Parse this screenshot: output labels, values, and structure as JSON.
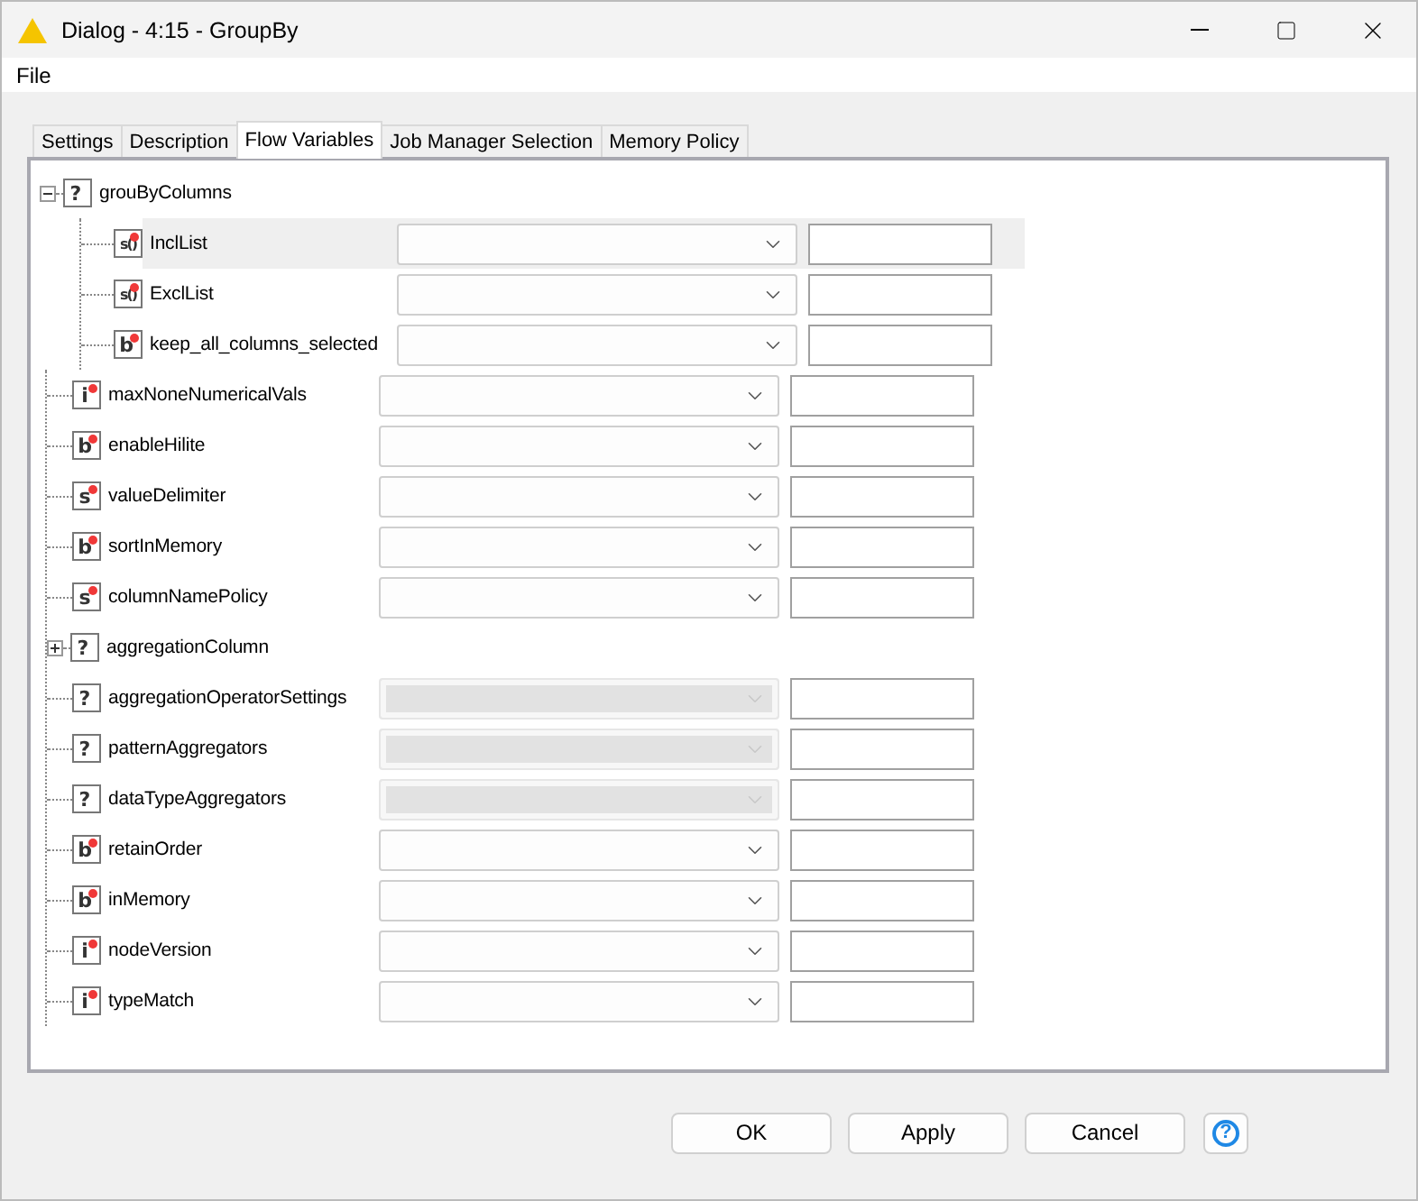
{
  "window": {
    "title": "Dialog - 4:15 - GroupBy"
  },
  "menu": [
    "File"
  ],
  "tabs": [
    {
      "label": "Settings",
      "selected": false
    },
    {
      "label": "Description",
      "selected": false
    },
    {
      "label": "Flow Variables",
      "selected": true
    },
    {
      "label": "Job Manager Selection",
      "selected": false
    },
    {
      "label": "Memory Policy",
      "selected": false
    }
  ],
  "tree": [
    {
      "name": "grouByColumns",
      "glyph": "?",
      "kind": "config",
      "expanded": true,
      "children": [
        {
          "name": "InclList",
          "glyph": "s()",
          "kind": "variable",
          "selected": true,
          "disabled": false
        },
        {
          "name": "ExclList",
          "glyph": "s()",
          "kind": "variable",
          "selected": false,
          "disabled": false
        },
        {
          "name": "keep_all_columns_selected",
          "glyph": "b",
          "kind": "variable",
          "selected": false,
          "disabled": false
        }
      ]
    },
    {
      "name": "maxNoneNumericalVals",
      "glyph": "i",
      "kind": "variable",
      "selected": false,
      "disabled": false
    },
    {
      "name": "enableHilite",
      "glyph": "b",
      "kind": "variable",
      "selected": false,
      "disabled": false
    },
    {
      "name": "valueDelimiter",
      "glyph": "s",
      "kind": "variable",
      "selected": false,
      "disabled": false
    },
    {
      "name": "sortInMemory",
      "glyph": "b",
      "kind": "variable",
      "selected": false,
      "disabled": false
    },
    {
      "name": "columnNamePolicy",
      "glyph": "s",
      "kind": "variable",
      "selected": false,
      "disabled": false
    },
    {
      "name": "aggregationColumn",
      "glyph": "?",
      "kind": "config",
      "expanded": false
    },
    {
      "name": "aggregationOperatorSettings",
      "glyph": "?",
      "kind": "setting",
      "selected": false,
      "disabled": true
    },
    {
      "name": "patternAggregators",
      "glyph": "?",
      "kind": "setting",
      "selected": false,
      "disabled": true
    },
    {
      "name": "dataTypeAggregators",
      "glyph": "?",
      "kind": "setting",
      "selected": false,
      "disabled": true
    },
    {
      "name": "retainOrder",
      "glyph": "b",
      "kind": "variable",
      "selected": false,
      "disabled": false
    },
    {
      "name": "inMemory",
      "glyph": "b",
      "kind": "variable",
      "selected": false,
      "disabled": false
    },
    {
      "name": "nodeVersion",
      "glyph": "i",
      "kind": "variable",
      "selected": false,
      "disabled": false
    },
    {
      "name": "typeMatch",
      "glyph": "i",
      "kind": "variable",
      "selected": false,
      "disabled": false
    }
  ],
  "buttons": [
    "OK",
    "Apply",
    "Cancel"
  ],
  "help": "?"
}
